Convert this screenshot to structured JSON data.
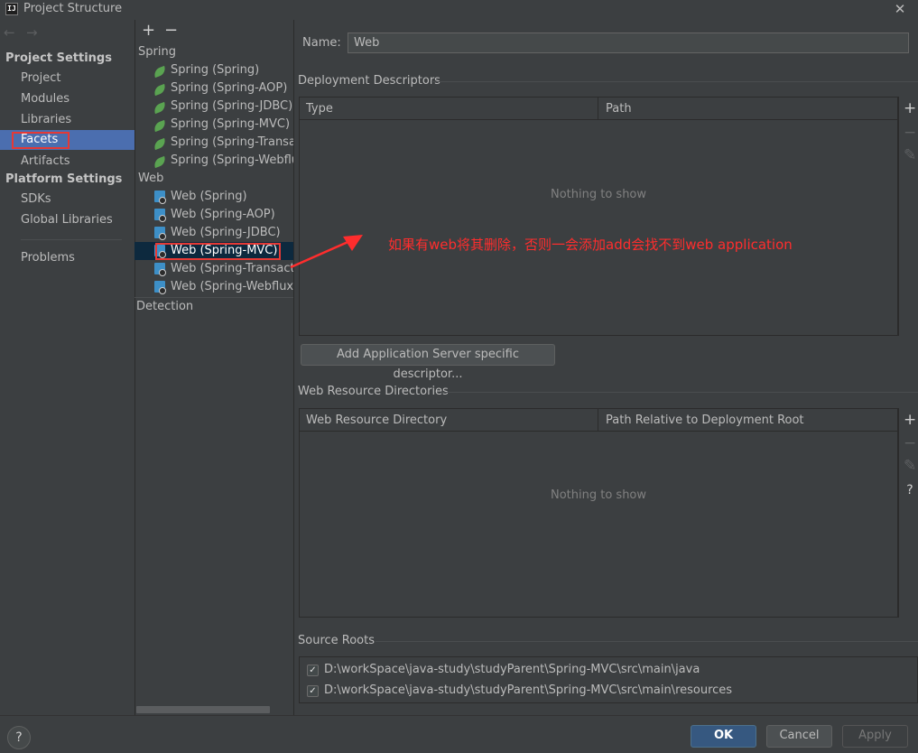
{
  "window": {
    "icon_text": "IJ",
    "title": "Project Structure",
    "close": "✕"
  },
  "nav": {
    "back": "←",
    "forward": "→",
    "project_settings_header": "Project Settings",
    "project_items": [
      "Project",
      "Modules",
      "Libraries",
      "Facets",
      "Artifacts"
    ],
    "selected": "Facets",
    "platform_settings_header": "Platform Settings",
    "platform_items": [
      "SDKs",
      "Global Libraries"
    ],
    "problems": "Problems"
  },
  "tree": {
    "add": "+",
    "remove": "−",
    "spring_group": "Spring",
    "spring_items": [
      "Spring (Spring)",
      "Spring (Spring-AOP)",
      "Spring (Spring-JDBC)",
      "Spring (Spring-MVC)",
      "Spring (Spring-Transac",
      "Spring (Spring-Webflux"
    ],
    "web_group": "Web",
    "web_items": [
      "Web (Spring)",
      "Web (Spring-AOP)",
      "Web (Spring-JDBC)",
      "Web (Spring-MVC)",
      "Web (Spring-Transactic",
      "Web (Spring-Webflux)"
    ],
    "selected": "Web (Spring-MVC)",
    "detection": "Detection"
  },
  "content": {
    "name_label": "Name:",
    "name_value": "Web",
    "deployment_title": "Deployment Descriptors",
    "deployment_headers": [
      "Type",
      "Path"
    ],
    "deployment_empty": "Nothing to show",
    "add_descriptor_button": "Add Application Server specific descriptor...",
    "resource_title": "Web Resource Directories",
    "resource_headers": [
      "Web Resource Directory",
      "Path Relative to Deployment Root"
    ],
    "resource_empty": "Nothing to show",
    "source_roots_title": "Source Roots",
    "source_roots": [
      {
        "checked": true,
        "path": "D:\\workSpace\\java-study\\studyParent\\Spring-MVC\\src\\main\\java"
      },
      {
        "checked": true,
        "path": "D:\\workSpace\\java-study\\studyParent\\Spring-MVC\\src\\main\\resources"
      }
    ],
    "side_tools": {
      "add": "+",
      "remove": "−",
      "edit": "✎",
      "help": "?"
    }
  },
  "annotation": {
    "text": "如果有web将其删除，否则一会添加add会找不到web application",
    "color": "#ff2d2d"
  },
  "footer": {
    "help": "?",
    "ok": "OK",
    "cancel": "Cancel",
    "apply": "Apply"
  },
  "colors": {
    "background": "#3c3f41",
    "selection_nav": "#4b6eaf",
    "selection_tree": "#0d293e",
    "highlight_box": "#e53935",
    "ok_button": "#365880"
  }
}
